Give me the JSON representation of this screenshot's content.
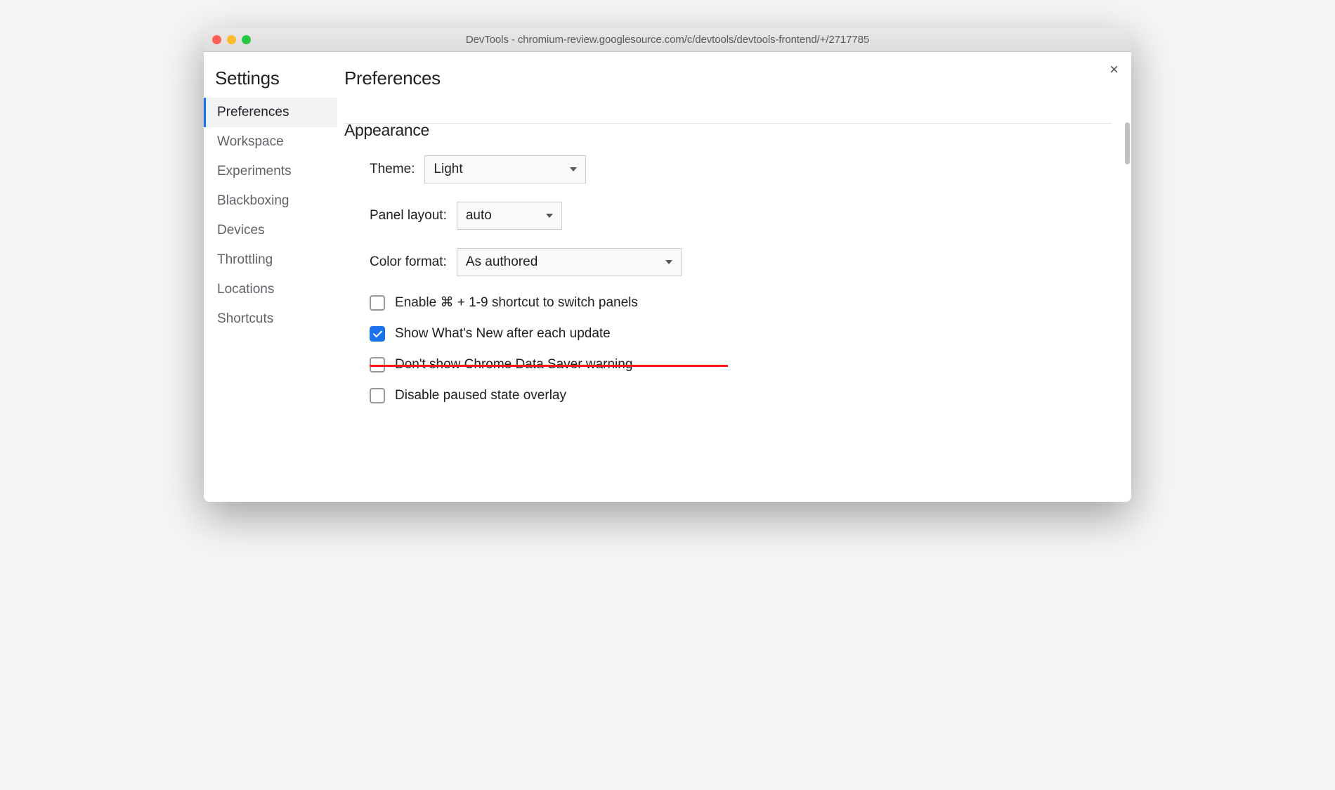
{
  "window": {
    "title": "DevTools - chromium-review.googlesource.com/c/devtools/devtools-frontend/+/2717785"
  },
  "sidebar": {
    "heading": "Settings",
    "items": [
      {
        "label": "Preferences",
        "active": true
      },
      {
        "label": "Workspace",
        "active": false
      },
      {
        "label": "Experiments",
        "active": false
      },
      {
        "label": "Blackboxing",
        "active": false
      },
      {
        "label": "Devices",
        "active": false
      },
      {
        "label": "Throttling",
        "active": false
      },
      {
        "label": "Locations",
        "active": false
      },
      {
        "label": "Shortcuts",
        "active": false
      }
    ]
  },
  "main": {
    "title": "Preferences",
    "close_icon": "×",
    "section": {
      "title": "Appearance",
      "theme": {
        "label": "Theme:",
        "value": "Light"
      },
      "panel_layout": {
        "label": "Panel layout:",
        "value": "auto"
      },
      "color_format": {
        "label": "Color format:",
        "value": "As authored"
      },
      "checkboxes": [
        {
          "label": "Enable ⌘ + 1-9 shortcut to switch panels",
          "checked": false,
          "struck": false
        },
        {
          "label": "Show What's New after each update",
          "checked": true,
          "struck": false
        },
        {
          "label": "Don't show Chrome Data Saver warning",
          "checked": false,
          "struck": true
        },
        {
          "label": "Disable paused state overlay",
          "checked": false,
          "struck": false
        }
      ]
    }
  }
}
